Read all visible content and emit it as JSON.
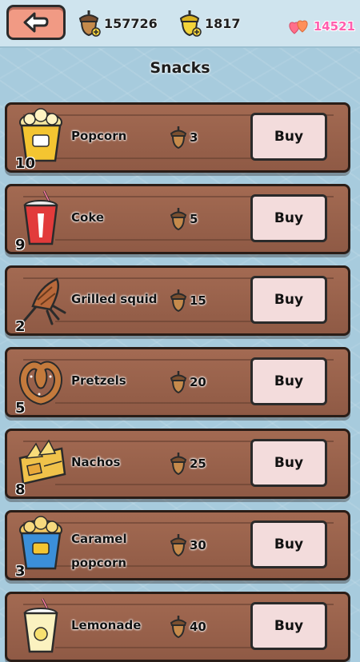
{
  "header": {
    "acorns": "157726",
    "golden_acorns": "1817",
    "hearts": "14521",
    "back_icon": "back-arrow-icon"
  },
  "title": "Snacks",
  "items": [
    {
      "name": "Popcorn",
      "qty": "10",
      "price": "3",
      "buy": "Buy",
      "icon": "popcorn-icon"
    },
    {
      "name": "Coke",
      "qty": "9",
      "price": "5",
      "buy": "Buy",
      "icon": "coke-cup-icon"
    },
    {
      "name": "Grilled squid",
      "qty": "2",
      "price": "15",
      "buy": "Buy",
      "icon": "grilled-squid-icon"
    },
    {
      "name": "Pretzels",
      "qty": "5",
      "price": "20",
      "buy": "Buy",
      "icon": "pretzel-icon"
    },
    {
      "name": "Nachos",
      "qty": "8",
      "price": "25",
      "buy": "Buy",
      "icon": "nachos-icon"
    },
    {
      "name_line1": "Caramel",
      "name_line2": "popcorn",
      "qty": "3",
      "price": "30",
      "buy": "Buy",
      "icon": "caramel-popcorn-icon"
    },
    {
      "name": "Lemonade",
      "price": "40",
      "buy": "Buy",
      "icon": "lemonade-icon"
    }
  ],
  "colors": {
    "buy_button": "#f3dcdc",
    "plank": "#9a634c",
    "heart_text": "#ff5fae",
    "back_button": "#f19a84"
  }
}
